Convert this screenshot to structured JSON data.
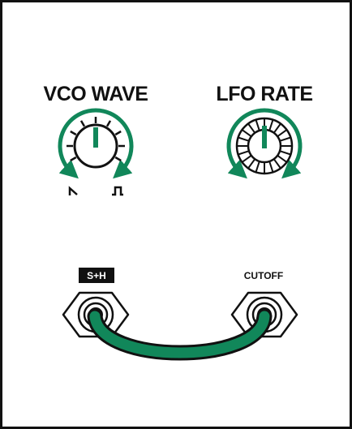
{
  "panel": {
    "knobs": [
      {
        "id": "vco-wave",
        "label": "VCO WAVE",
        "style": "open",
        "range_icons": [
          "saw-wave-icon",
          "square-wave-icon"
        ]
      },
      {
        "id": "lfo-rate",
        "label": "LFO RATE",
        "style": "ridged"
      }
    ],
    "jacks": [
      {
        "id": "s-h",
        "label": "S+H",
        "label_style": "inverted"
      },
      {
        "id": "cutoff",
        "label": "CUTOFF",
        "label_style": "plain"
      }
    ],
    "cable": {
      "from": "S+H",
      "to": "CUTOFF",
      "color": "#11875a"
    }
  },
  "colors": {
    "accent": "#11875a",
    "ink": "#111111",
    "panel_bg": "#ffffff"
  }
}
